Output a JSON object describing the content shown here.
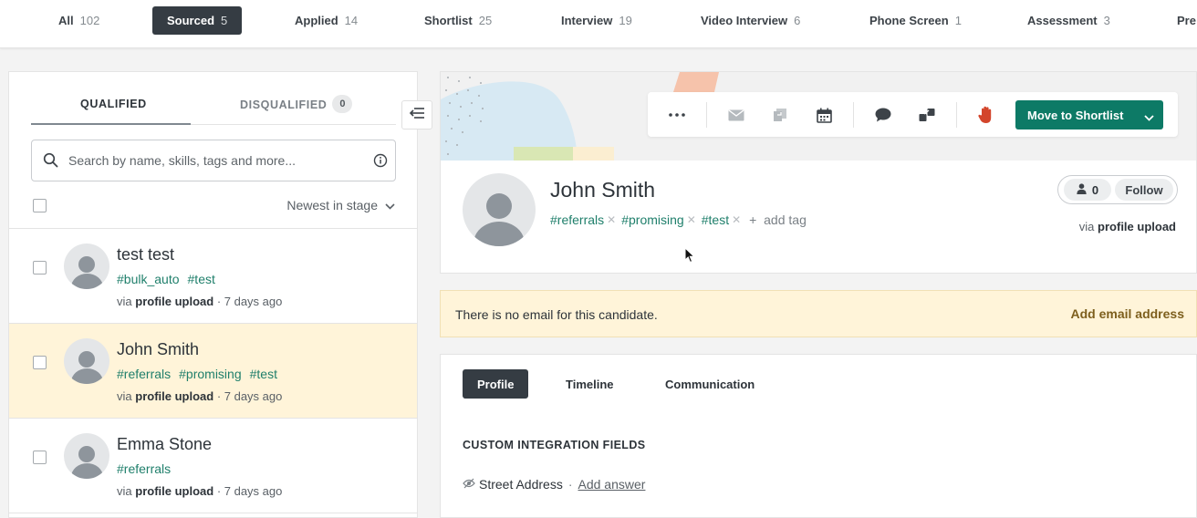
{
  "stages": [
    {
      "label": "All",
      "count": "102",
      "active": false
    },
    {
      "label": "Sourced",
      "count": "5",
      "active": true
    },
    {
      "label": "Applied",
      "count": "14",
      "active": false
    },
    {
      "label": "Shortlist",
      "count": "25",
      "active": false
    },
    {
      "label": "Interview",
      "count": "19",
      "active": false
    },
    {
      "label": "Video Interview",
      "count": "6",
      "active": false
    },
    {
      "label": "Phone Screen",
      "count": "1",
      "active": false
    },
    {
      "label": "Assessment",
      "count": "3",
      "active": false
    },
    {
      "label": "Pre",
      "count": "",
      "active": false
    }
  ],
  "left_panel": {
    "tab_qualified": "QUALIFIED",
    "tab_disqualified": "DISQUALIFIED",
    "disqualified_count": "0",
    "search_placeholder": "Search by name, skills, tags and more...",
    "sort_label": "Newest in stage",
    "candidates": [
      {
        "name": "test test",
        "tags": [
          "#bulk_auto",
          "#test"
        ],
        "via_prefix": "via",
        "via_source": "profile upload",
        "when": " · 7 days ago",
        "selected": false
      },
      {
        "name": "John Smith",
        "tags": [
          "#referrals",
          "#promising",
          "#test"
        ],
        "via_prefix": "via",
        "via_source": "profile upload",
        "when": " · 7 days ago",
        "selected": true
      },
      {
        "name": "Emma Stone",
        "tags": [
          "#referrals"
        ],
        "via_prefix": "via",
        "via_source": "profile upload",
        "when": " · 7 days ago",
        "selected": false
      }
    ]
  },
  "actions": {
    "move_label": "Move to Shortlist",
    "icons": [
      "more-icon",
      "email-icon",
      "copy-icon",
      "calendar-icon",
      "comment-icon",
      "transfer-icon",
      "stop-hand-icon"
    ]
  },
  "profile": {
    "name": "John Smith",
    "tags": [
      "#referrals",
      "#promising",
      "#test"
    ],
    "add_tag": "add tag",
    "follower_count": "0",
    "follow_label": "Follow",
    "via_prefix": "via",
    "via_source": "profile upload"
  },
  "email_notice": {
    "message": "There is no email for this candidate.",
    "action": "Add email address"
  },
  "detail": {
    "tabs": [
      "Profile",
      "Timeline",
      "Communication"
    ],
    "active_tab": "Profile",
    "section_title": "CUSTOM INTEGRATION FIELDS",
    "field_label": "Street Address",
    "field_sep": "·",
    "field_action": "Add answer"
  },
  "colors": {
    "accent": "#0d7a66",
    "tag": "#1f7f6b",
    "dark": "#353c43",
    "notice_bg": "#fff4d9"
  }
}
